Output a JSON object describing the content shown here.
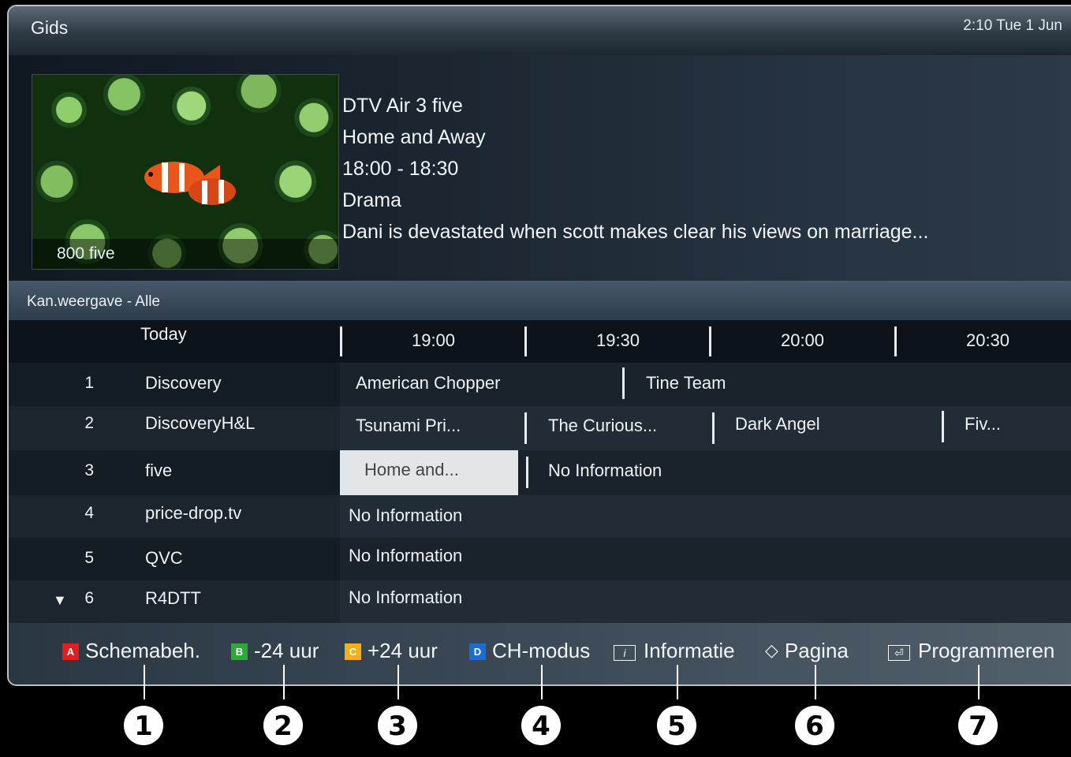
{
  "header": {
    "title": "Gids",
    "clock": "2:10 Tue 1 Jun"
  },
  "preview": {
    "channel_caption": "800 five",
    "info_lines": [
      "DTV Air 3 five",
      "Home and Away",
      "18:00 - 18:30",
      "Drama",
      "Dani is devastated when scott makes clear his views on marriage..."
    ]
  },
  "filter": {
    "label": "Kan.weergave - Alle"
  },
  "timeline": {
    "day": "Today",
    "slots": [
      "19:00",
      "19:30",
      "20:00",
      "20:30"
    ]
  },
  "channels": [
    {
      "number": "1",
      "name": "Discovery",
      "programs": [
        "American Chopper",
        "Tine Team"
      ]
    },
    {
      "number": "2",
      "name": "DiscoveryH&L",
      "programs": [
        "Tsunami Pri...",
        "The Curious...",
        "Dark Angel",
        "Fiv..."
      ]
    },
    {
      "number": "3",
      "name": "five",
      "programs": [
        "Home and...",
        "No Information"
      ]
    },
    {
      "number": "4",
      "name": "price-drop.tv",
      "programs": [
        "No Information"
      ]
    },
    {
      "number": "5",
      "name": "QVC",
      "programs": [
        "No Information"
      ]
    },
    {
      "number": "6",
      "name": "R4DTT",
      "programs": [
        "No Information"
      ],
      "more_indicator": "▼"
    }
  ],
  "footer": {
    "items": [
      {
        "key": "A",
        "label": "Schemabeh.",
        "color": "#e0201f",
        "callout": "1"
      },
      {
        "key": "B",
        "label": "-24 uur",
        "color": "#2fa83a",
        "callout": "2"
      },
      {
        "key": "C",
        "label": "+24 uur",
        "color": "#f4b117",
        "callout": "3"
      },
      {
        "key": "D",
        "label": "CH-modus",
        "color": "#1a6ed2",
        "callout": "4"
      },
      {
        "icon": "info-icon",
        "icon_glyph": "i",
        "label": "Informatie",
        "callout": "5"
      },
      {
        "icon": "updown-icon",
        "icon_glyph": "◇",
        "label": "Pagina",
        "callout": "6"
      },
      {
        "icon": "enter-icon",
        "icon_glyph": "⏎",
        "label": "Programmeren",
        "callout": "7"
      }
    ]
  }
}
